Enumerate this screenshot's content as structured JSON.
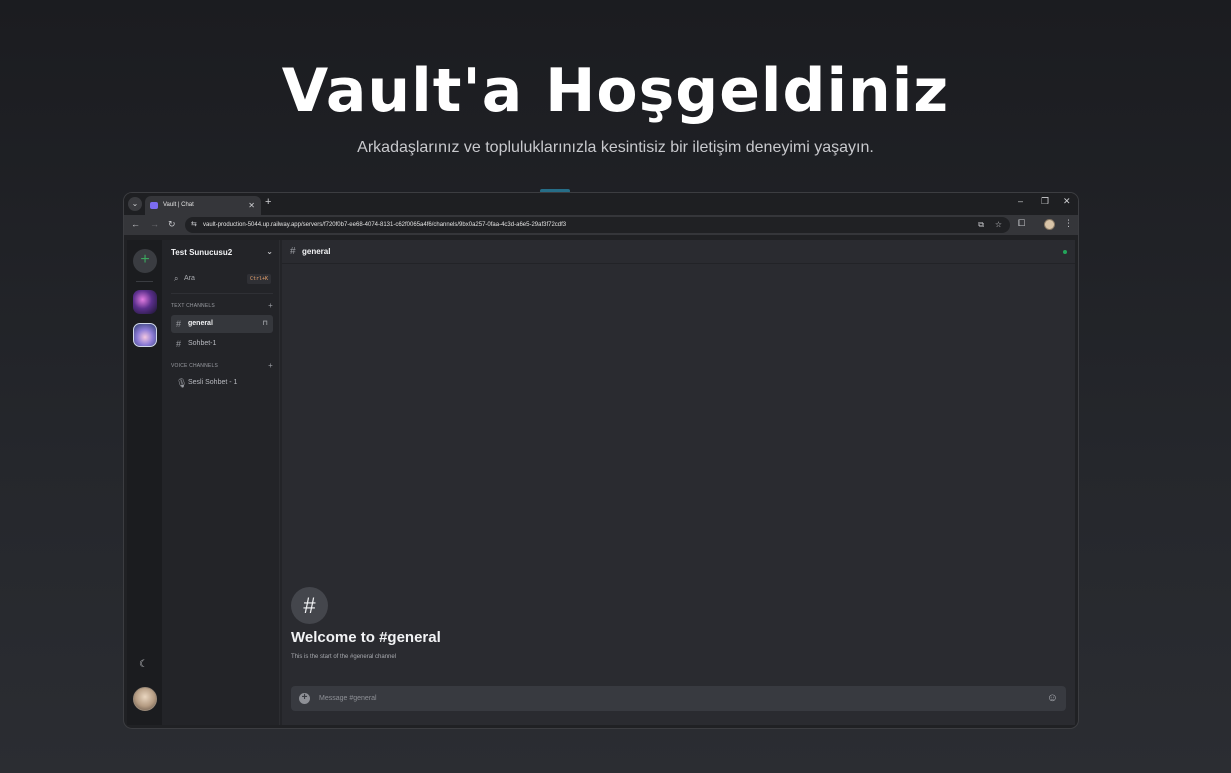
{
  "hero": {
    "title": "Vault'a Hoşgeldiniz",
    "subtitle": "Arkadaşlarınız ve topluluklarınızla kesintisiz bir iletişim deneyimi yaşayın."
  },
  "browser": {
    "tab_title": "Vault | Chat",
    "url": "vault-production-5044.up.railway.app/servers/f720f0b7-ee68-4074-8131-c62f0065a4f6/channels/9bx0a257-0faa-4c3d-a6e5-29af3f72cdf3"
  },
  "sidebar": {
    "server_name": "Test Sunucusu2",
    "search_placeholder": "Ara",
    "search_shortcut": "Ctrl+K",
    "text_category": "TEXT CHANNELS",
    "voice_category": "VOICE CHANNELS",
    "text_channels": [
      {
        "label": "general"
      },
      {
        "label": "Sohbet-1"
      }
    ],
    "voice_channels": [
      {
        "label": "Sesli Sohbet - 1"
      }
    ]
  },
  "chat": {
    "channel_name": "general",
    "welcome_title": "Welcome to #general",
    "welcome_subtitle": "This is the start of the #general channel",
    "composer_placeholder": "Message #general"
  },
  "colors": {
    "accent_online": "#23a55a",
    "add_server": "#3ba55d",
    "favicon": "#7c6cf0"
  }
}
